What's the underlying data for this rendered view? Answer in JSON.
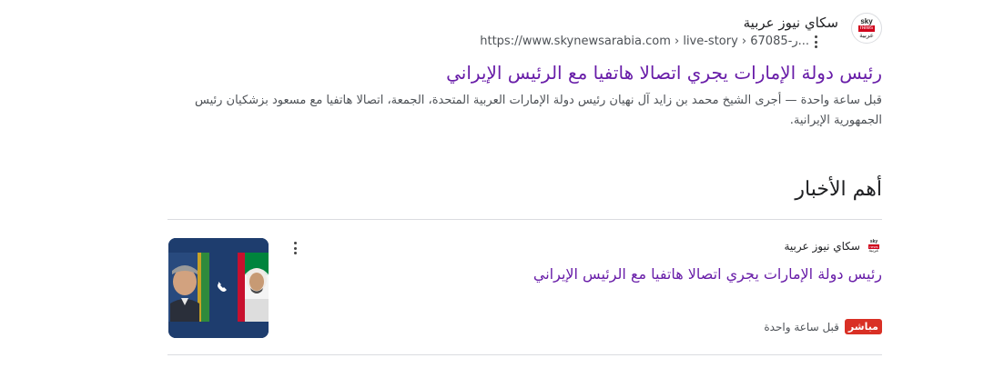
{
  "result": {
    "site_name": "سكاي نيوز عربية",
    "url": "https://www.skynewsarabia.com › live-story › 67085-ر...",
    "title": "رئيس دولة الإمارات يجري اتصالا هاتفيا مع الرئيس الإيراني",
    "snippet_time": "قبل ساعة واحدة",
    "snippet_text": "أجرى الشيخ محمد بن زايد آل نهيان رئيس دولة الإمارات العربية المتحدة، الجمعة، اتصالا هاتفيا مع مسعود بزشكيان رئيس الجمهورية الإيرانية.",
    "snippet_separator": "—"
  },
  "logo": {
    "sky": "sky",
    "news": "news",
    "arabic": "عربية"
  },
  "top_stories": {
    "heading": "أهم الأخبار",
    "card": {
      "source": "سكاي نيوز عربية",
      "title": "رئيس دولة الإمارات يجري اتصالا هاتفيا مع الرئيس الإيراني",
      "badge": "مباشر",
      "time": "قبل ساعة واحدة"
    }
  },
  "icons": [
    "more-vert-icon",
    "phone-icon"
  ],
  "colors": {
    "link_visited": "#681da8",
    "live_red": "#d93025",
    "text": "#202124",
    "muted": "#4d5156"
  }
}
